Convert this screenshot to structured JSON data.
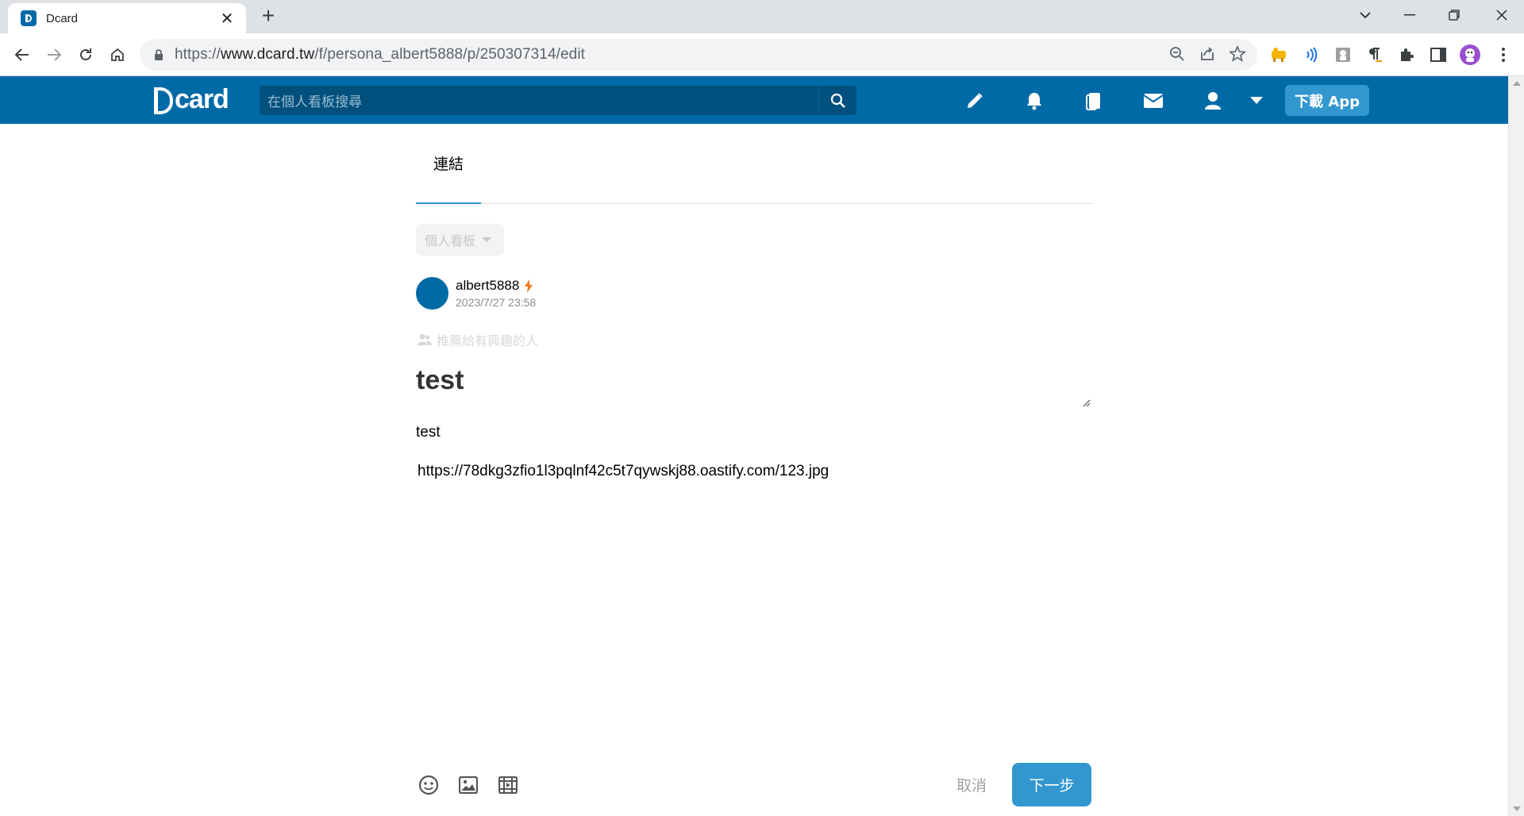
{
  "browser": {
    "tab_title": "Dcard",
    "tab_close": "✕",
    "new_tab": "+",
    "url_prefix": "https://",
    "url_host": "www.dcard.tw",
    "url_path": "/f/persona_albert5888/p/250307314/edit",
    "icons": [
      "back-icon",
      "forward-icon",
      "reload-icon",
      "home-icon",
      "lock-icon",
      "zoom-icon",
      "share-icon",
      "star-icon",
      "extensions-icon",
      "side-panel-icon",
      "profile-avatar",
      "menu-icon"
    ]
  },
  "header": {
    "logo_text": "card",
    "search_placeholder": "在個人看板搜尋",
    "download_app": "下載 App",
    "brand_color": "#006aa6",
    "accent_color": "#3397cf"
  },
  "editor": {
    "tab_label": "連結",
    "forum_select": "個人看板",
    "author": "albert5888",
    "timestamp": "2023/7/27 23:58",
    "recommend_label": "推薦給有興趣的人",
    "title": "test",
    "body_text": "test",
    "body_link": "https://78dkg3zfio1l3pqlnf42c5t7qywskj88.oastify.com/123.jpg"
  },
  "footer": {
    "cancel": "取消",
    "next": "下一步"
  }
}
